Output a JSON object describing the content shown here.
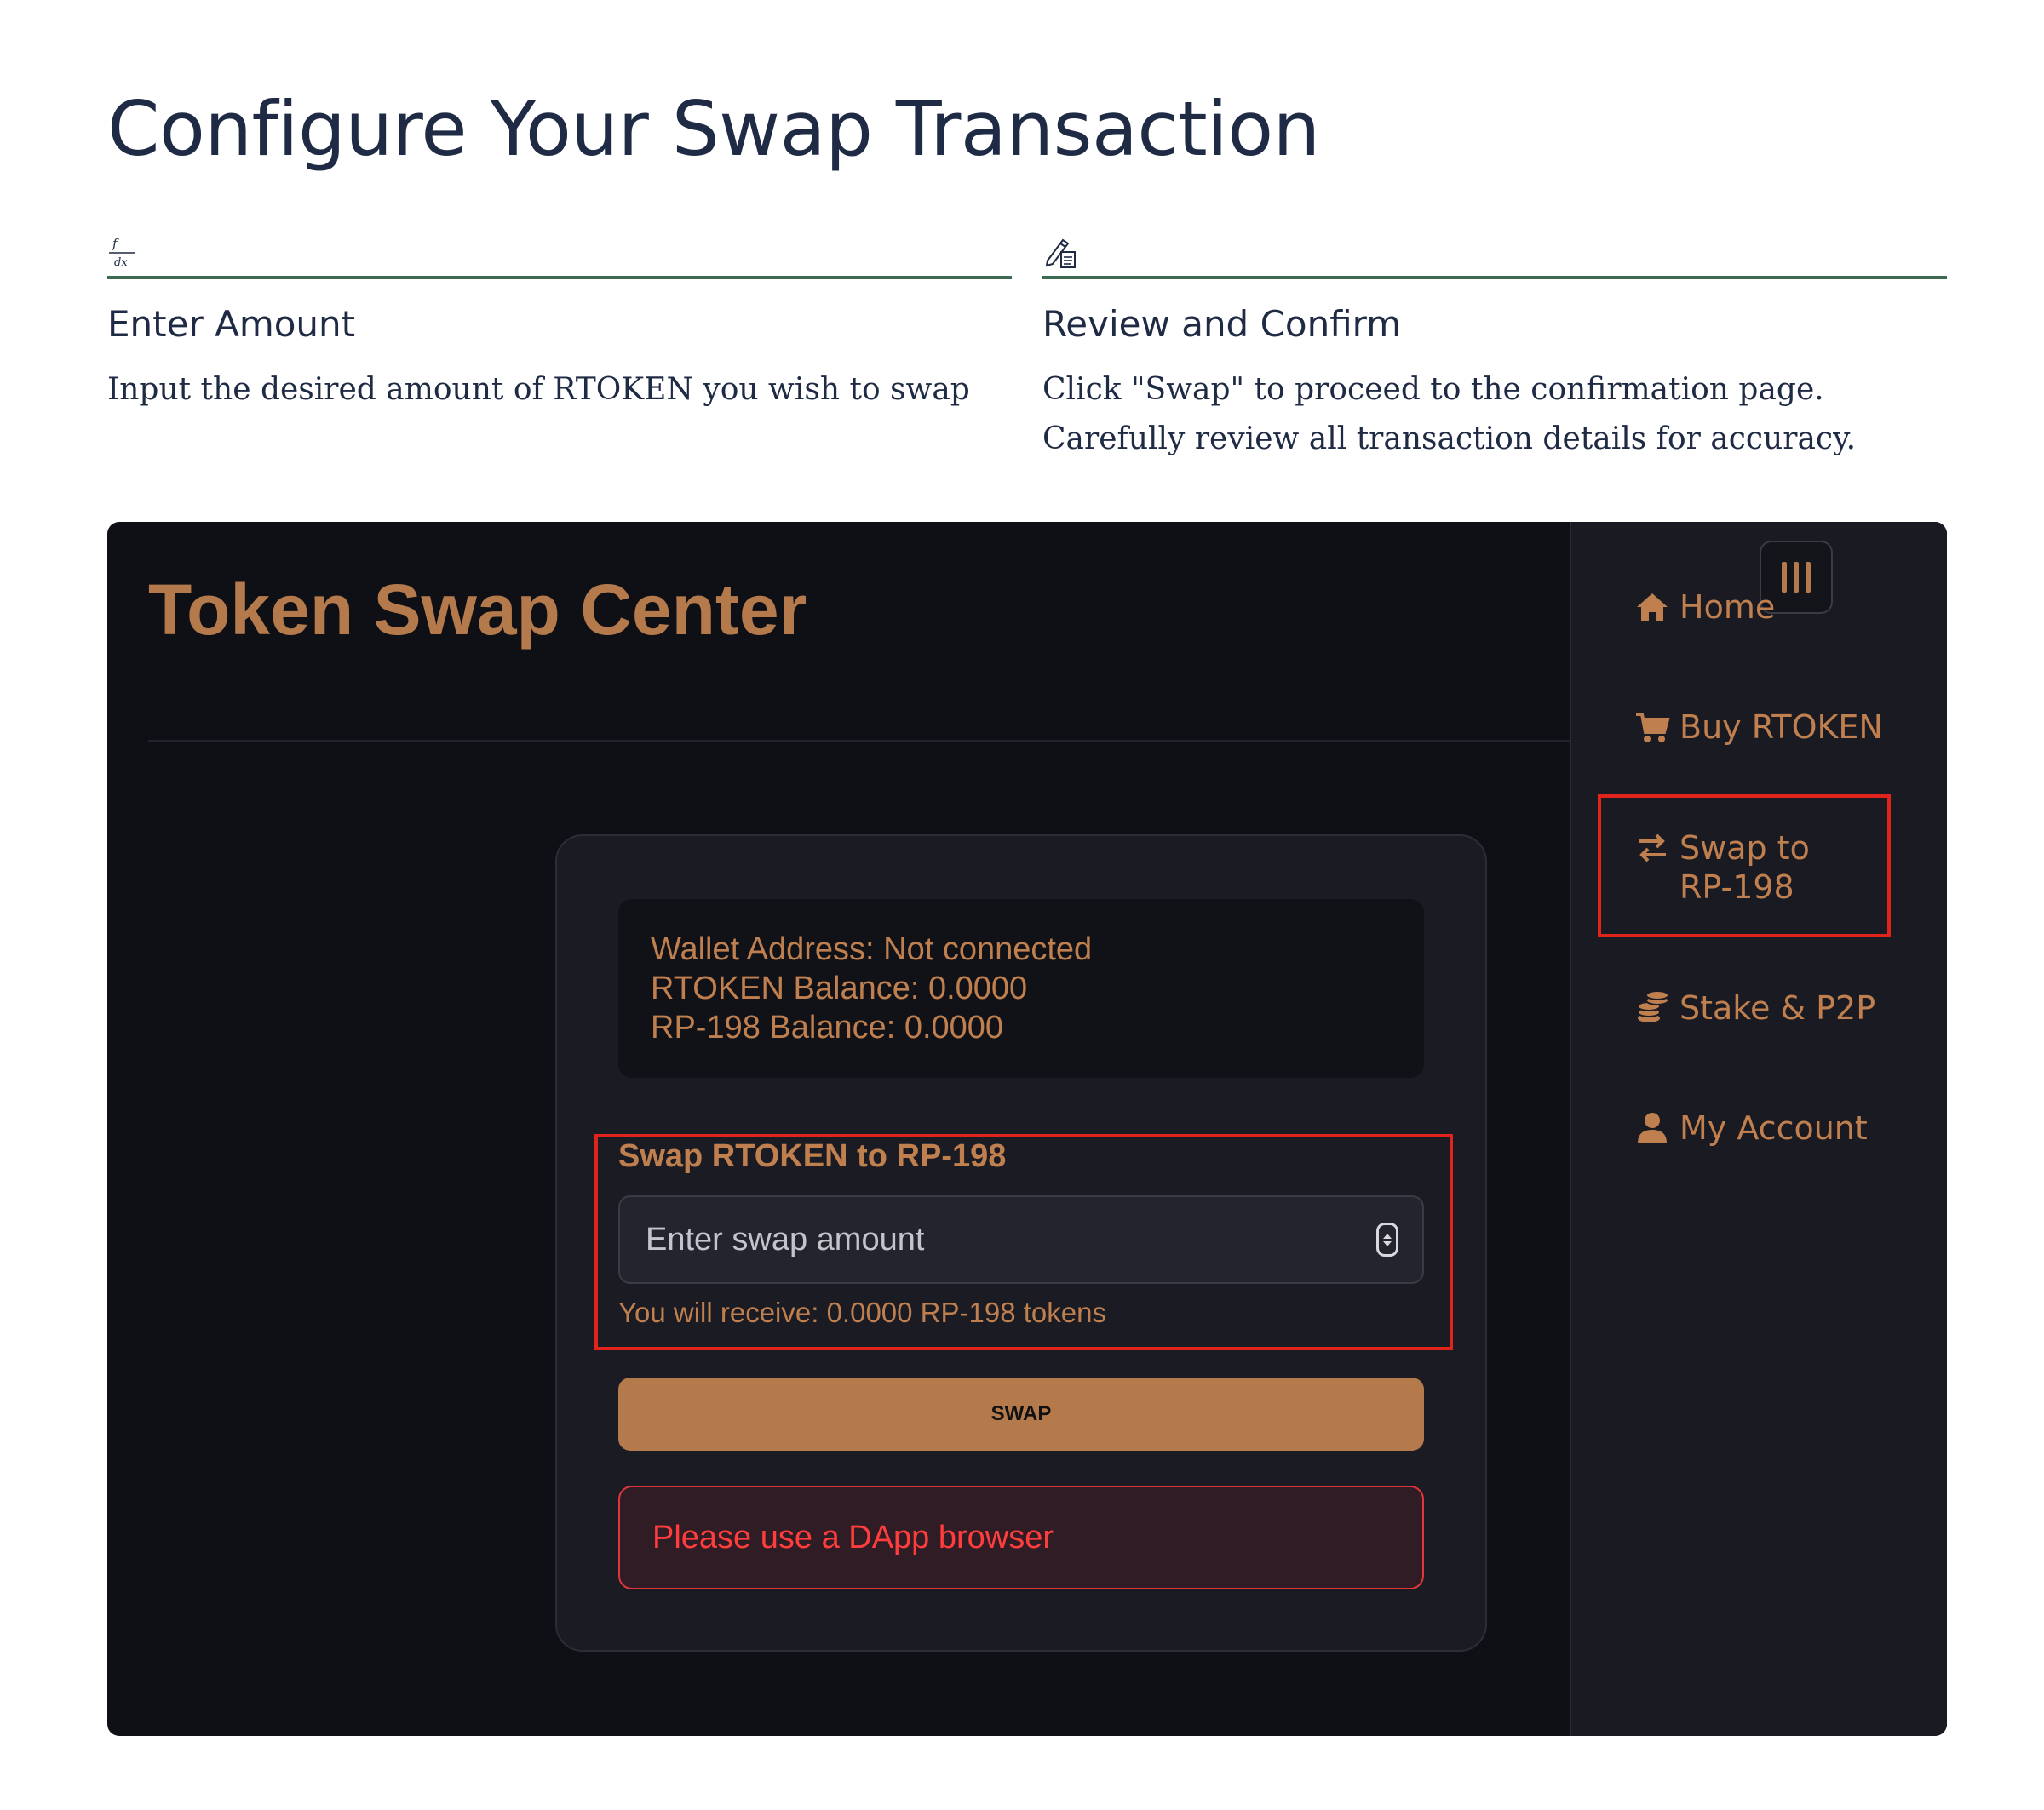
{
  "page": {
    "title": "Configure Your Swap Transaction"
  },
  "steps": [
    {
      "icon": "formula-icon",
      "title": "Enter Amount",
      "description": "Input the desired amount of RTOKEN you wish to swap"
    },
    {
      "icon": "edit-document-icon",
      "title": "Review and Confirm",
      "description": "Click \"Swap\" to proceed to the confirmation page. Carefully review all transaction details for accuracy."
    }
  ],
  "app": {
    "title": "Token Swap Center",
    "nav": {
      "home": "Home",
      "buy": "Buy RTOKEN",
      "swap": "Swap to RP-198",
      "stake": "Stake & P2P",
      "account": "My Account"
    },
    "wallet": {
      "address": "Wallet Address: Not connected",
      "rtoken_balance": "RTOKEN Balance: 0.0000",
      "rp_balance": "RP-198 Balance: 0.0000"
    },
    "swap": {
      "label": "Swap RTOKEN to RP-198",
      "placeholder": "Enter swap amount",
      "receive": "You will receive: 0.0000 RP-198 tokens",
      "button": "SWAP"
    },
    "error": "Please use a DApp browser",
    "colors": {
      "accent": "#b57a4c",
      "background": "#0f1016",
      "error": "#ff3d3d",
      "highlight": "#e0231b"
    }
  }
}
